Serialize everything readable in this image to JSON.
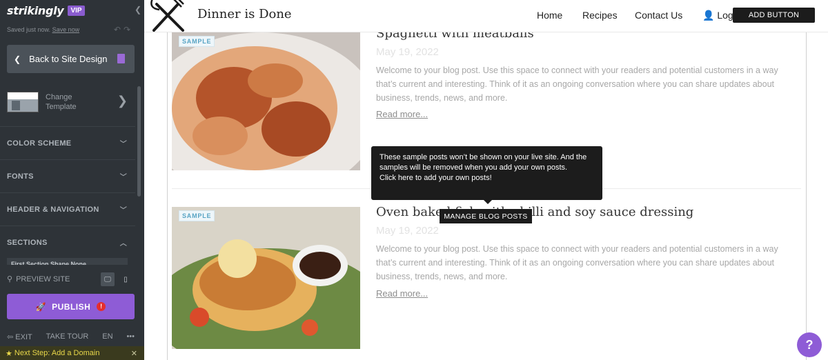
{
  "editor": {
    "brand": "strikingly",
    "vip_badge": "VIP",
    "saved_status": "Saved just now.",
    "save_now": "Save now",
    "back_button": "Back to Site Design",
    "template_label": "Change Template",
    "sections": [
      {
        "label": "COLOR SCHEME"
      },
      {
        "label": "FONTS"
      },
      {
        "label": "HEADER & NAVIGATION"
      },
      {
        "label": "SECTIONS"
      }
    ],
    "section_strip": "First Section Shape      None",
    "preview": "PREVIEW SITE",
    "publish": "PUBLISH",
    "footer": {
      "exit": "EXIT",
      "tour": "TAKE TOUR",
      "lang": "EN",
      "more": "•••"
    },
    "next_step": "Next Step: Add a Domain",
    "accent_color": "#8e5cd6"
  },
  "site": {
    "title": "Dinner is Done",
    "nav": [
      "Home",
      "Recipes",
      "Contact Us"
    ],
    "login": "Login",
    "add_button": "ADD BUTTON",
    "posts": [
      {
        "badge": "SAMPLE",
        "title": "Spaghetti with meatballs",
        "date": "May 19, 2022",
        "body": "Welcome to your blog post. Use this space to connect with your readers and potential customers in a way that’s current and interesting. Think of it as an ongoing conversation where you can share updates about business, trends, news, and more.",
        "read_more": "Read more..."
      },
      {
        "badge": "SAMPLE",
        "title": "Oven baked fish with chilli and soy sauce dressing",
        "date": "May 19, 2022",
        "body": "Welcome to your blog post. Use this space to connect with your readers and potential customers in a way that’s current and interesting. Think of it as an ongoing conversation where you can share updates about business, trends, news, and more.",
        "read_more": "Read more..."
      }
    ],
    "tooltip": {
      "line1": "These sample posts won’t be shown on your live site. And the samples will be removed when you add your own posts.",
      "line2": "Click here to add your own posts!"
    },
    "manage_button": "MANAGE BLOG POSTS",
    "help": "?"
  }
}
